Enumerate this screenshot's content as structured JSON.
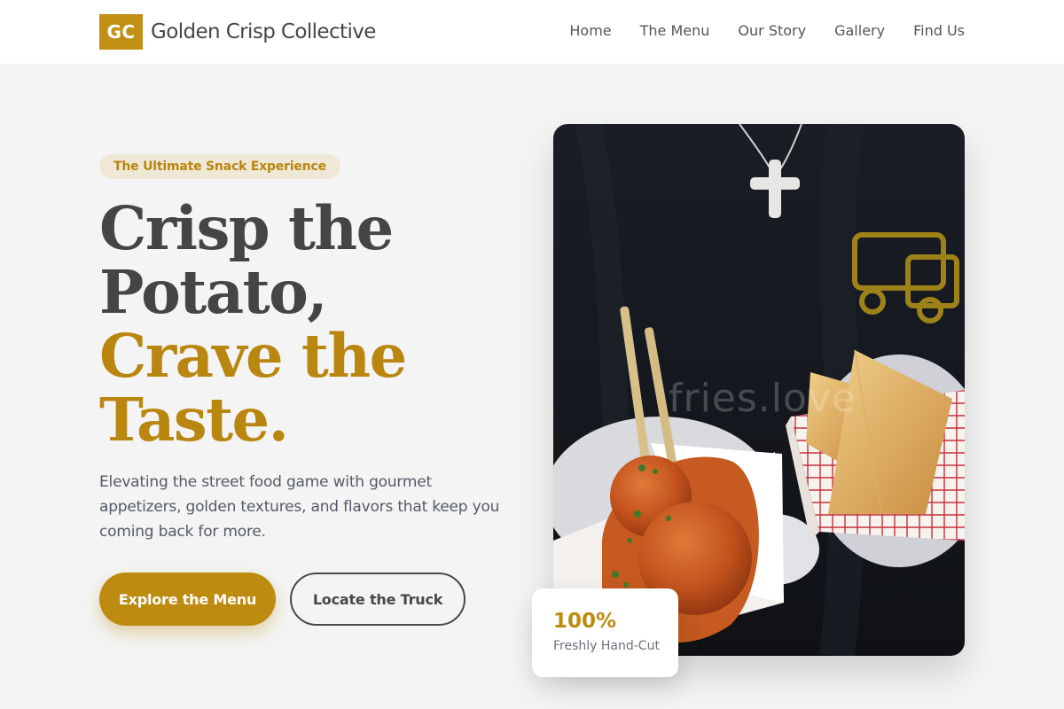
{
  "brand": {
    "mark": "GC",
    "name": "Golden Crisp Collective",
    "accent_color": "#c08f14"
  },
  "nav": {
    "items": [
      {
        "label": "Home"
      },
      {
        "label": "The Menu"
      },
      {
        "label": "Our Story"
      },
      {
        "label": "Gallery"
      },
      {
        "label": "Find Us"
      }
    ]
  },
  "hero": {
    "badge": "The Ultimate Snack Experience",
    "headline_dark": [
      "Crisp the",
      "Potato,"
    ],
    "headline_gold": [
      "Crave the",
      "Taste."
    ],
    "description": "Elevating the street food game with gourmet appetizers, golden textures, and flavors that keep you coming back for more.",
    "primary_cta": "Explore the Menu",
    "secondary_cta": "Locate the Truck",
    "image": {
      "watermark": "fries.love"
    }
  },
  "stat": {
    "value": "100%",
    "label": "Freshly Hand-Cut"
  }
}
